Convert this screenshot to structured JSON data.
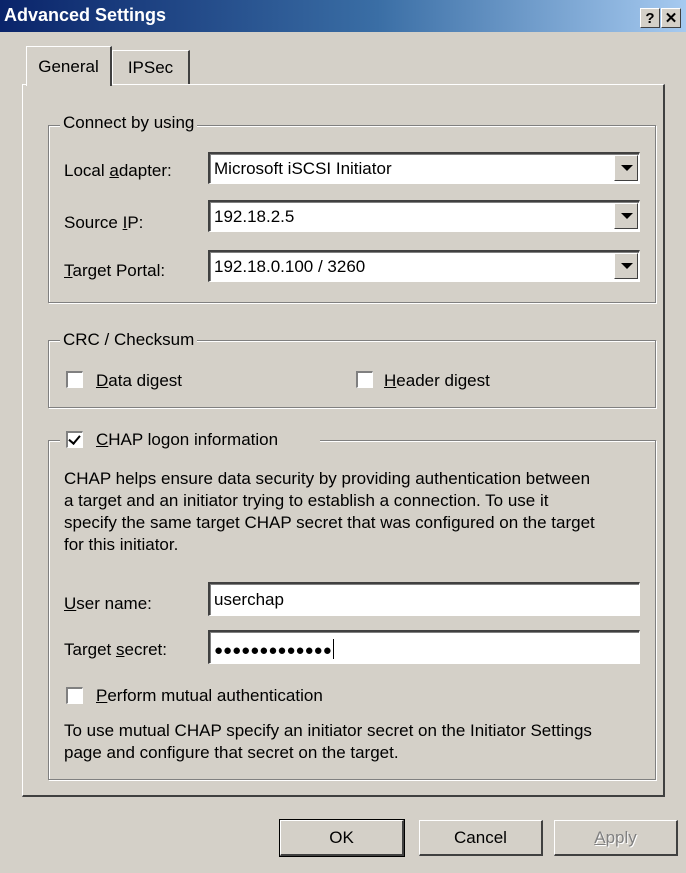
{
  "window": {
    "title": "Advanced Settings",
    "help_label": "?",
    "close_label": "✕"
  },
  "tabs": [
    {
      "label": "General",
      "active": true
    },
    {
      "label": "IPSec",
      "active": false
    }
  ],
  "connect": {
    "legend": "Connect by using",
    "local_adapter": {
      "label_pre": "Local ",
      "label_key": "a",
      "label_post": "dapter:",
      "value": "Microsoft iSCSI Initiator"
    },
    "source_ip": {
      "label_pre": "Source ",
      "label_key": "I",
      "label_post": "P:",
      "value": "192.18.2.5"
    },
    "target_portal": {
      "label_pre": "",
      "label_key": "T",
      "label_post": "arget Portal:",
      "value": "192.18.0.100 / 3260"
    }
  },
  "crc": {
    "legend": "CRC / Checksum",
    "data_digest": {
      "label_key": "D",
      "label_post": "ata digest",
      "checked": false
    },
    "header_digest": {
      "label_key": "H",
      "label_post": "eader digest",
      "checked": false
    }
  },
  "chap": {
    "legend_key": "C",
    "legend_post": "HAP logon information",
    "checked": true,
    "description": [
      "CHAP helps ensure data security by providing authentication between",
      "a target and an initiator trying to establish a connection. To use it",
      "specify the same target CHAP secret that was configured on the target",
      "for this initiator."
    ],
    "user_name": {
      "label_key": "U",
      "label_post": "ser name:",
      "value": "userchap"
    },
    "target_secret": {
      "label_pre": "Target ",
      "label_key": "s",
      "label_post": "ecret:",
      "value": "●●●●●●●●●●●●●"
    },
    "mutual": {
      "label_key": "P",
      "label_post": "erform mutual authentication",
      "checked": false
    },
    "mutual_note": [
      "To use mutual CHAP specify an initiator secret on the Initiator Settings",
      "page and configure that secret on the target."
    ]
  },
  "buttons": {
    "ok": "OK",
    "cancel": "Cancel",
    "apply_key": "A",
    "apply_post": "pply"
  }
}
